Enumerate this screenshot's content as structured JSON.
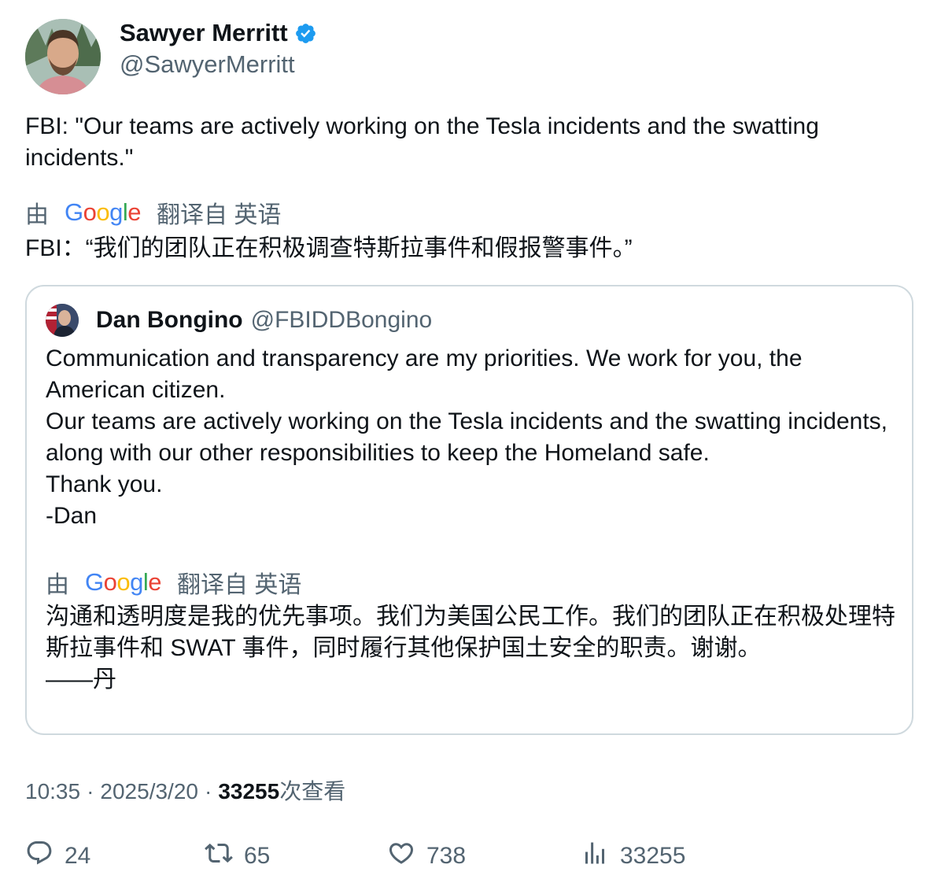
{
  "author": {
    "name": "Sawyer Merritt",
    "handle": "@SawyerMerritt",
    "verified_color": "#1d9bf0"
  },
  "tweet": {
    "text": "FBI: \"Our teams are actively working on the Tesla incidents and the swatting incidents.\"",
    "translate_prefix": "由",
    "translate_brand": "Google",
    "translate_suffix": "翻译自 英语",
    "translated_text": "FBI：“我们的团队正在积极调查特斯拉事件和假报警事件。”"
  },
  "quoted": {
    "name": "Dan Bongino",
    "handle": "@FBIDDBongino",
    "text": "Communication and transparency are my priorities. We work for you, the American citizen.\nOur teams are actively working on the Tesla incidents and the swatting incidents, along with our other responsibilities to keep the Homeland safe.\nThank you.\n-Dan",
    "translate_prefix": "由",
    "translate_brand": "Google",
    "translate_suffix": "翻译自 英语",
    "translated_text": "沟通和透明度是我的优先事项。我们为美国公民工作。我们的团队正在积极处理特斯拉事件和 SWAT 事件，同时履行其他保护国土安全的职责。谢谢。\n——丹"
  },
  "meta": {
    "time": "10:35",
    "date": "2025/3/20",
    "views_count": "33255",
    "views_label": "次查看"
  },
  "actions": {
    "replies": "24",
    "reposts": "65",
    "likes": "738",
    "views": "33255"
  },
  "icons": {
    "reply": "reply-icon",
    "repost": "repost-icon",
    "like": "heart-icon",
    "views": "views-chart-icon"
  }
}
